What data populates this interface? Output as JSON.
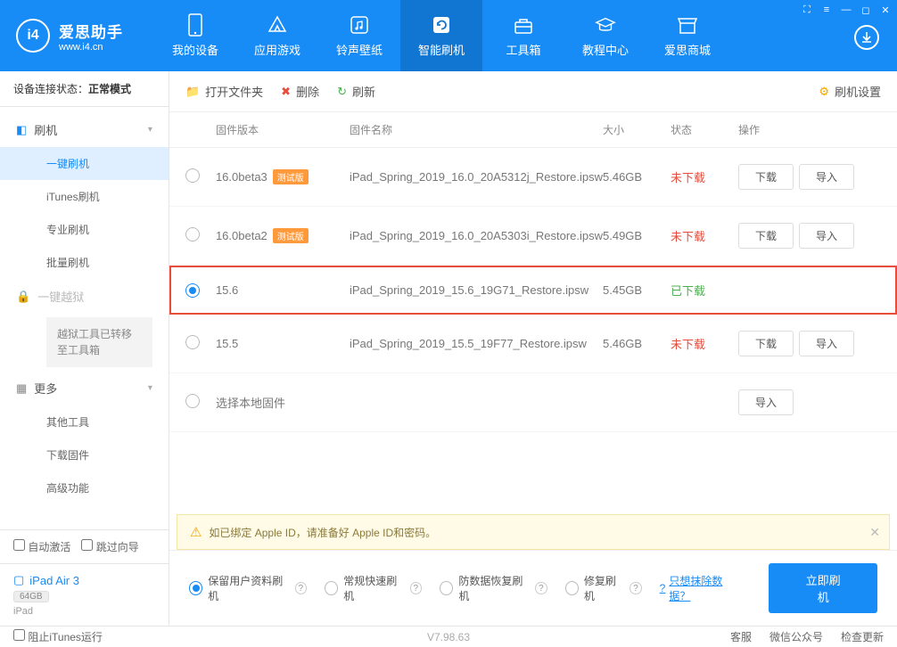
{
  "logo": {
    "title": "爱思助手",
    "sub": "www.i4.cn"
  },
  "nav": {
    "device": "我的设备",
    "apps": "应用游戏",
    "ringtones": "铃声壁纸",
    "flash": "智能刷机",
    "tools": "工具箱",
    "tutorial": "教程中心",
    "store": "爱思商城"
  },
  "sidebar": {
    "conn_pre": "设备连接状态：",
    "conn_mode": "正常模式",
    "group_flash": "刷机",
    "items": {
      "0": "一键刷机",
      "1": "iTunes刷机",
      "2": "专业刷机",
      "3": "批量刷机"
    },
    "group_jb": "一键越狱",
    "jb_notice": "越狱工具已转移至工具箱",
    "group_more": "更多",
    "more": {
      "0": "其他工具",
      "1": "下载固件",
      "2": "高级功能"
    },
    "auto_activate": "自动激活",
    "skip_wizard": "跳过向导",
    "device_name": "iPad Air 3",
    "device_cap": "64GB",
    "device_type": "iPad"
  },
  "toolbar": {
    "open": "打开文件夹",
    "delete": "删除",
    "refresh": "刷新",
    "settings": "刷机设置"
  },
  "thead": {
    "ver": "固件版本",
    "name": "固件名称",
    "size": "大小",
    "status": "状态",
    "action": "操作"
  },
  "rows": [
    {
      "ver": "16.0beta3",
      "beta": "测试版",
      "name": "iPad_Spring_2019_16.0_20A5312j_Restore.ipsw",
      "size": "5.46GB",
      "status": "未下载",
      "downloaded": false
    },
    {
      "ver": "16.0beta2",
      "beta": "测试版",
      "name": "iPad_Spring_2019_16.0_20A5303i_Restore.ipsw",
      "size": "5.49GB",
      "status": "未下载",
      "downloaded": false
    },
    {
      "ver": "15.6",
      "beta": "",
      "name": "iPad_Spring_2019_15.6_19G71_Restore.ipsw",
      "size": "5.45GB",
      "status": "已下载",
      "downloaded": true,
      "selected": true
    },
    {
      "ver": "15.5",
      "beta": "",
      "name": "iPad_Spring_2019_15.5_19F77_Restore.ipsw",
      "size": "5.46GB",
      "status": "未下载",
      "downloaded": false
    }
  ],
  "local_fw": "选择本地固件",
  "btn": {
    "download": "下载",
    "import": "导入"
  },
  "info": "如已绑定 Apple ID，请准备好 Apple ID和密码。",
  "options": {
    "0": "保留用户资料刷机",
    "1": "常规快速刷机",
    "2": "防数据恢复刷机",
    "3": "修复刷机",
    "link": "只想抹除数据？"
  },
  "flash_btn": "立即刷机",
  "footer": {
    "block_itunes": "阻止iTunes运行",
    "version": "V7.98.63",
    "support": "客服",
    "wechat": "微信公众号",
    "update": "检查更新"
  }
}
